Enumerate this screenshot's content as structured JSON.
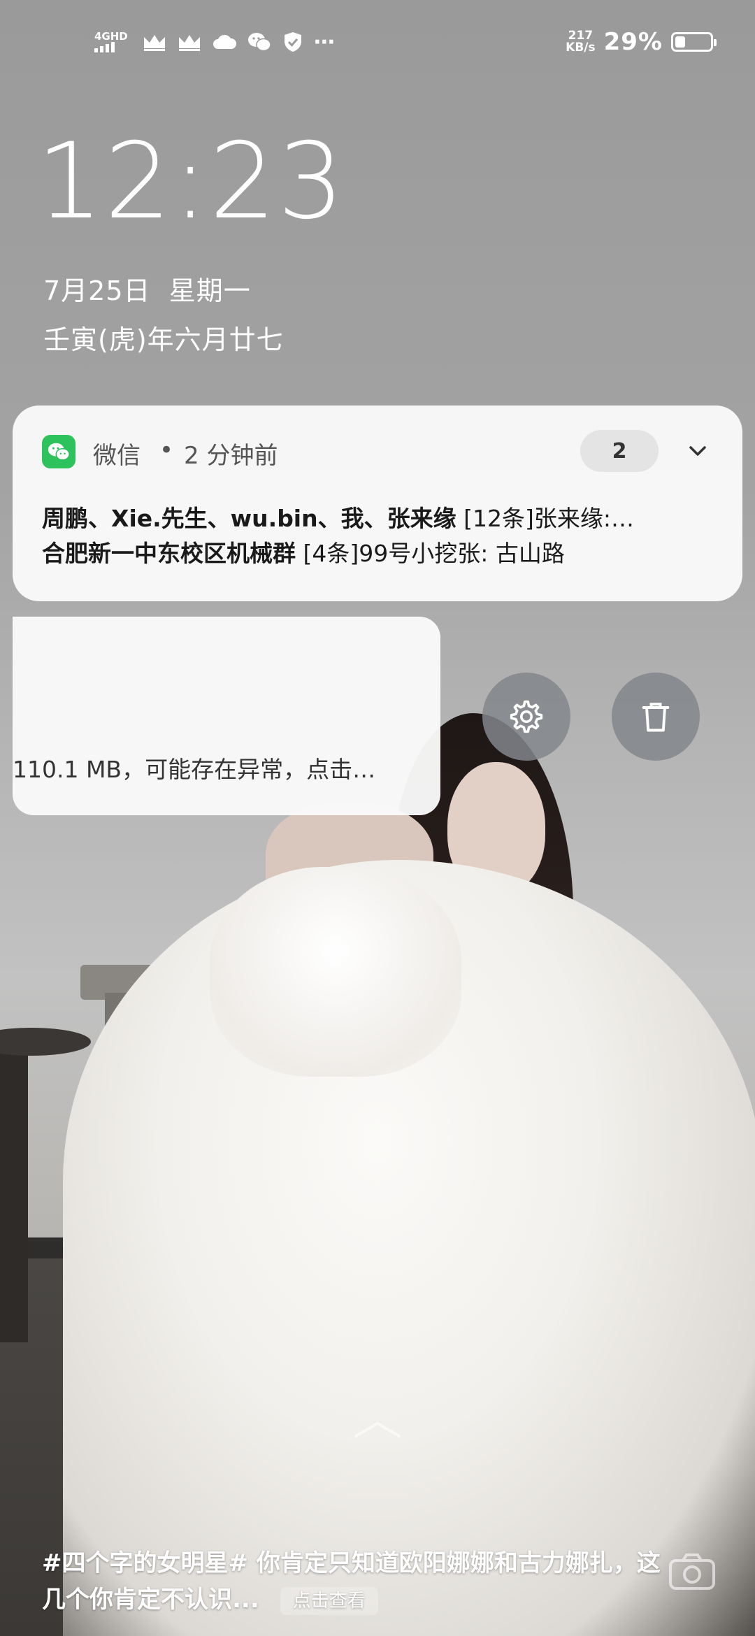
{
  "status_bar": {
    "network_type": "4GHD",
    "net_speed_value": "217",
    "net_speed_unit": "KB/s",
    "battery_percent": "29%",
    "battery_level": 0.29,
    "more_icon": "⋯"
  },
  "lockscreen": {
    "time": "12:23",
    "date": "7月25日  星期一",
    "lunar_date": "壬寅(虎)年六月廿七"
  },
  "wechat_notification": {
    "app_name": "微信",
    "separator": "•",
    "time_ago": "2 分钟前",
    "count": "2",
    "messages": [
      {
        "sender": "周鹏、Xie.先生、wu.bin、我、张来缘",
        "preview": "[12条]张来缘:…"
      },
      {
        "sender": "合肥新一中东校区机械群",
        "preview": "[4条]99号小挖张: 古山路"
      }
    ]
  },
  "swiped_notification": {
    "text": "110.1 MB，可能存在异常，点击…"
  },
  "actions": {
    "settings_icon": "gear-icon",
    "delete_icon": "trash-icon"
  },
  "magazine": {
    "caption": "#四个字的女明星# 你肯定只知道欧阳娜娜和古力娜扎，这几个你肯定不认识...",
    "button_label": "点击查看"
  },
  "colors": {
    "wechat_green": "#2dc25b",
    "card_bg": "#fafafa",
    "action_bg": "#82868c"
  }
}
